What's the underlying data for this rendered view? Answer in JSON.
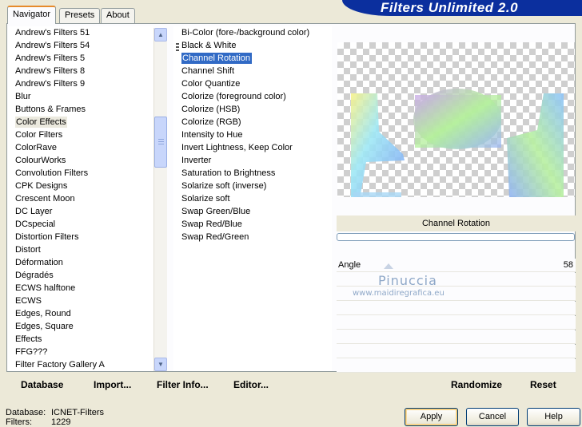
{
  "banner": {
    "title": "Filters Unlimited 2.0"
  },
  "tabs": [
    {
      "label": "Navigator",
      "active": true
    },
    {
      "label": "Presets",
      "active": false
    },
    {
      "label": "About",
      "active": false
    }
  ],
  "categories": {
    "selected": "Color Effects",
    "items": [
      "Andrew's Filters 51",
      "Andrew's Filters 54",
      "Andrew's Filters 5",
      "Andrew's Filters 8",
      "Andrew's Filters 9",
      "Blur",
      "Buttons & Frames",
      "Color Effects",
      "Color Filters",
      "ColorRave",
      "ColourWorks",
      "Convolution Filters",
      "CPK Designs",
      "Crescent Moon",
      "DC Layer",
      "DCspecial",
      "Distortion Filters",
      "Distort",
      "Déformation",
      "Dégradés",
      "ECWS halftone",
      "ECWS",
      "Edges, Round",
      "Edges, Square",
      "Effects",
      "FFG???",
      "Filter Factory Gallery A"
    ]
  },
  "filters": {
    "selected": "Channel Rotation",
    "items": [
      "Bi-Color (fore-/background color)",
      "Black & White",
      "Channel Rotation",
      "Channel Shift",
      "Color Quantize",
      "Colorize (foreground color)",
      "Colorize (HSB)",
      "Colorize (RGB)",
      "Intensity to Hue",
      "Invert Lightness, Keep Color",
      "Inverter",
      "Saturation to Brightness",
      "Solarize soft (inverse)",
      "Solarize soft",
      "Swap Green/Blue",
      "Swap Red/Blue",
      "Swap Red/Green"
    ]
  },
  "preview": {
    "filter_name": "Channel Rotation"
  },
  "params": [
    {
      "label": "Angle",
      "value": "58"
    }
  ],
  "watermark": {
    "name": "Pinuccia",
    "url": "www.maidiregrafica.eu"
  },
  "toolbar": {
    "database": "Database",
    "import": "Import...",
    "filter_info": "Filter Info...",
    "editor": "Editor...",
    "randomize": "Randomize",
    "reset": "Reset"
  },
  "footer": {
    "database_label": "Database:",
    "database_value": "ICNET-Filters",
    "filters_label": "Filters:",
    "filters_value": "1229"
  },
  "buttons": {
    "apply": "Apply",
    "cancel": "Cancel",
    "help": "Help"
  },
  "colors": {
    "banner": "#0b2f9e",
    "selection": "#316ac5",
    "tab_accent": "#e68b2c"
  }
}
